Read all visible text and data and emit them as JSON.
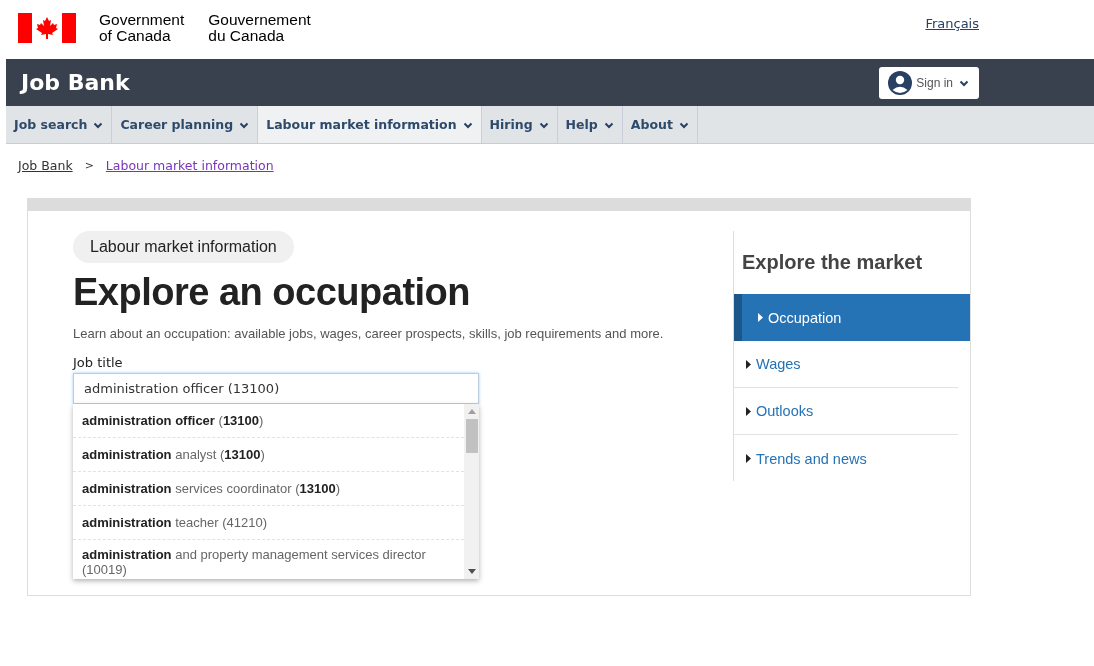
{
  "header": {
    "gov_en": [
      "Government",
      "of Canada"
    ],
    "gov_fr": [
      "Gouvernement",
      "du Canada"
    ],
    "language_link": "Français"
  },
  "app_bar": {
    "title": "Job Bank",
    "sign_in": "Sign in"
  },
  "nav": [
    {
      "label": "Job search",
      "selected": false
    },
    {
      "label": "Career planning",
      "selected": false
    },
    {
      "label": "Labour market information",
      "selected": true
    },
    {
      "label": "Hiring",
      "selected": false
    },
    {
      "label": "Help",
      "selected": false
    },
    {
      "label": "About",
      "selected": false
    }
  ],
  "breadcrumb_separator": ">",
  "breadcrumb": [
    {
      "label": "Job Bank",
      "visited": false
    },
    {
      "label": "Labour market information",
      "visited": true
    }
  ],
  "main": {
    "badge": "Labour market information",
    "heading": "Explore an occupation",
    "intro": "Learn about an occupation: available jobs, wages, career prospects, skills, job requirements and more.",
    "field_label": "Job title",
    "field_value": "administration officer (13100)",
    "suggestions": [
      "**administration officer** (**13100**)",
      "**administration** analyst (**13100**)",
      "**administration** services coordinator (**13100**)",
      "**administration** teacher (41210)",
      "**administration** and property management services director (10019)"
    ]
  },
  "sidebar": {
    "title": "Explore the market",
    "items": [
      {
        "label": "Occupation",
        "selected": true
      },
      {
        "label": "Wages",
        "selected": false
      },
      {
        "label": "Outlooks",
        "selected": false
      },
      {
        "label": "Trends and news",
        "selected": false
      }
    ]
  }
}
